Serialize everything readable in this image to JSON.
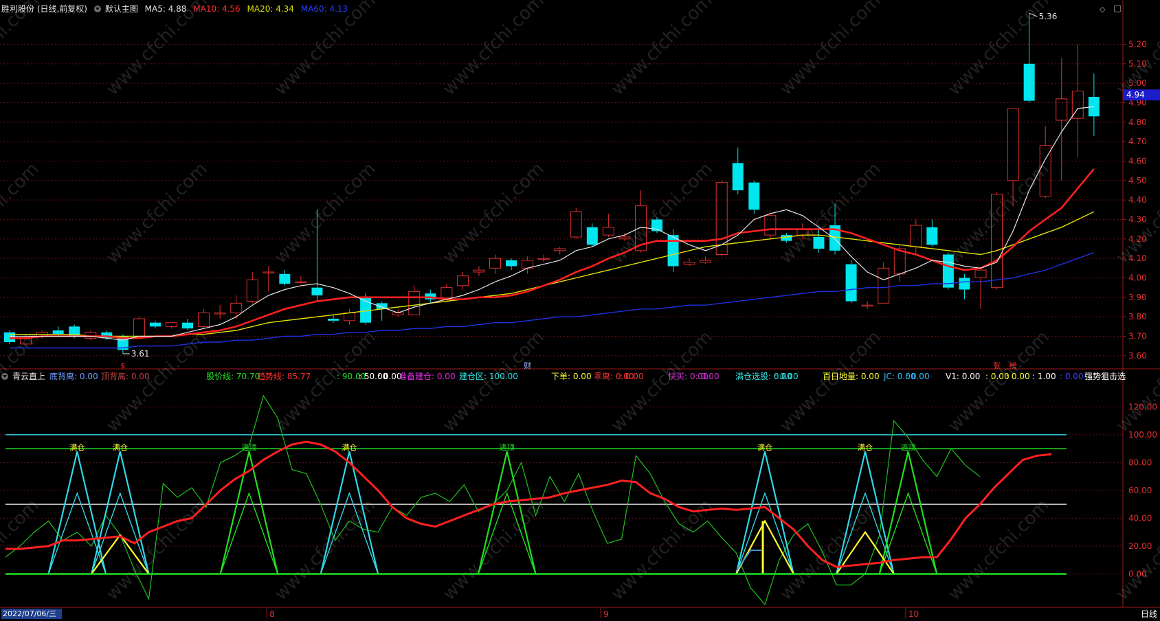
{
  "main_header": {
    "title": "胜利股份 (日线,前复权)",
    "template": "默认主图",
    "ma5": "MA5: 4.88",
    "ma10": "MA10: 4.56",
    "ma20": "MA20: 4.34",
    "ma60": "MA60: 4.13"
  },
  "sub_header": {
    "indicator": "青云直上",
    "items": [
      {
        "text": "底背离: 0.00",
        "color": "#6ea0ff"
      },
      {
        "text": "顶背离: 0.00",
        "color": "#c04040"
      },
      {
        "text": "股价线: 70.70",
        "color": "#20e020"
      },
      {
        "text": "趋势线: 85.77",
        "color": "#ff3030"
      },
      {
        "text": ": 90.00",
        "color": "#20e020"
      },
      {
        "text": ": 50.00",
        "color": "#ffffff"
      },
      {
        "text": ": 0.00",
        "color": "#ffffff"
      },
      {
        "text": "准备建仓: 0.00",
        "color": "#e030e0"
      },
      {
        "text": "建仓区: 100.00",
        "color": "#30e0e0"
      },
      {
        "text": "下单: 0.00",
        "color": "#ffff30"
      },
      {
        "text": "乖离: 0.00",
        "color": "#ff3030"
      },
      {
        "text": ": 0.00",
        "color": "#ff3030"
      },
      {
        "text": "快买: 0.00",
        "color": "#e030e0"
      },
      {
        "text": ": 0.00",
        "color": "#e030e0"
      },
      {
        "text": "满仓选股: 0.00",
        "color": "#30e0e0"
      },
      {
        "text": ": 0.00",
        "color": "#30e0e0"
      },
      {
        "text": "百日地量: 0.00",
        "color": "#ffff30"
      },
      {
        "text": "JC: 0.00",
        "color": "#30c0ff"
      },
      {
        "text": ": 0.00",
        "color": "#30c0ff"
      },
      {
        "text": "V1: 0.00",
        "color": "#ffffff"
      },
      {
        "text": ": 0.00",
        "color": "#ffff30"
      },
      {
        "text": ": 0.00",
        "color": "#ffff30"
      },
      {
        "text": ": 1.00",
        "color": "#ffffff"
      },
      {
        "text": ": 0.00",
        "color": "#4040ff"
      },
      {
        "text": "强势狙击选",
        "color": "#ffffff"
      }
    ]
  },
  "footer": {
    "date": "2022/07/06/三",
    "period": "日线"
  },
  "colors": {
    "up": "#e03030",
    "down": "#00e5ee",
    "ma5": "#e6e6e6",
    "ma10": "#ff2020",
    "ma20": "#e0e000",
    "ma60": "#2030e0",
    "grid": "#6a1010"
  },
  "chart_data": [
    {
      "type": "candlestick",
      "price_axis": [
        5.2,
        5.1,
        5.0,
        4.9,
        4.8,
        4.7,
        4.6,
        4.5,
        4.4,
        4.3,
        4.2,
        4.1,
        4.0,
        3.9,
        3.8,
        3.7,
        3.6
      ],
      "price_axis_labels": [
        "5.20",
        "5.10",
        "5.00",
        "4.90",
        "4.80",
        "4.70",
        "4.60",
        "4.50",
        "4.40",
        "4.30",
        "4.20",
        "4.10",
        "4.00",
        "3.90",
        "3.80",
        "3.70",
        "3.60"
      ],
      "ylim": [
        3.55,
        5.35
      ],
      "current_price": "4.94",
      "high_label": "5.36",
      "low_label": "3.61",
      "x_labels": [
        "8",
        "9",
        "10"
      ],
      "x_label_index": [
        18,
        41,
        62
      ],
      "markers": [
        {
          "index": 7,
          "text": "$",
          "color": "#ff3030"
        },
        {
          "index": 32,
          "text": "财",
          "color": "#8fb0ff"
        },
        {
          "index": 61,
          "text": "张",
          "color": "#ff3030"
        },
        {
          "index": 62,
          "text": "榜",
          "color": "#ff3030"
        }
      ],
      "candles": [
        [
          3.72,
          3.67,
          3.73,
          3.66
        ],
        [
          3.66,
          3.69,
          3.71,
          3.65
        ],
        [
          3.7,
          3.72,
          3.73,
          3.69
        ],
        [
          3.73,
          3.71,
          3.75,
          3.7
        ],
        [
          3.75,
          3.7,
          3.76,
          3.69
        ],
        [
          3.69,
          3.72,
          3.73,
          3.68
        ],
        [
          3.72,
          3.69,
          3.73,
          3.68
        ],
        [
          3.7,
          3.63,
          3.71,
          3.61
        ],
        [
          3.7,
          3.79,
          3.8,
          3.69
        ],
        [
          3.77,
          3.75,
          3.78,
          3.74
        ],
        [
          3.75,
          3.77,
          3.77,
          3.74
        ],
        [
          3.77,
          3.74,
          3.79,
          3.73
        ],
        [
          3.75,
          3.82,
          3.84,
          3.74
        ],
        [
          3.82,
          3.82,
          3.86,
          3.79
        ],
        [
          3.82,
          3.87,
          3.91,
          3.79
        ],
        [
          3.88,
          3.99,
          4.03,
          3.87
        ],
        [
          4.03,
          4.03,
          4.06,
          3.93
        ],
        [
          4.02,
          3.97,
          4.04,
          3.96
        ],
        [
          3.98,
          3.98,
          4.01,
          3.97
        ],
        [
          3.95,
          3.91,
          4.35,
          3.88
        ],
        [
          3.79,
          3.78,
          3.81,
          3.77
        ],
        [
          3.78,
          3.82,
          3.84,
          3.76
        ],
        [
          3.9,
          3.77,
          3.92,
          3.76
        ],
        [
          3.87,
          3.84,
          3.88,
          3.78
        ],
        [
          3.81,
          3.82,
          3.84,
          3.8
        ],
        [
          3.81,
          3.93,
          3.96,
          3.81
        ],
        [
          3.92,
          3.89,
          3.94,
          3.87
        ],
        [
          3.9,
          3.95,
          3.97,
          3.89
        ],
        [
          3.96,
          4.01,
          4.03,
          3.94
        ],
        [
          4.03,
          4.04,
          4.06,
          4.01
        ],
        [
          4.05,
          4.1,
          4.12,
          4.02
        ],
        [
          4.09,
          4.06,
          4.1,
          4.04
        ],
        [
          4.05,
          4.09,
          4.11,
          4.02
        ],
        [
          4.1,
          4.1,
          4.12,
          4.08
        ],
        [
          4.14,
          4.15,
          4.16,
          4.12
        ],
        [
          4.21,
          4.34,
          4.36,
          4.2
        ],
        [
          4.26,
          4.17,
          4.28,
          4.16
        ],
        [
          4.22,
          4.26,
          4.33,
          4.21
        ],
        [
          4.2,
          4.21,
          4.23,
          4.19
        ],
        [
          4.14,
          4.37,
          4.45,
          4.13
        ],
        [
          4.3,
          4.24,
          4.31,
          4.23
        ],
        [
          4.22,
          4.06,
          4.25,
          4.03
        ],
        [
          4.07,
          4.08,
          4.1,
          4.06
        ],
        [
          4.08,
          4.09,
          4.11,
          4.07
        ],
        [
          4.12,
          4.49,
          4.5,
          4.11
        ],
        [
          4.59,
          4.45,
          4.67,
          4.43
        ],
        [
          4.49,
          4.35,
          4.5,
          4.33
        ],
        [
          4.22,
          4.32,
          4.34,
          4.2
        ],
        [
          4.22,
          4.19,
          4.23,
          4.18
        ],
        [
          4.22,
          4.25,
          4.28,
          4.2
        ],
        [
          4.21,
          4.15,
          4.26,
          4.13
        ],
        [
          4.27,
          4.14,
          4.38,
          4.12
        ],
        [
          4.07,
          3.88,
          4.09,
          3.87
        ],
        [
          3.86,
          3.86,
          3.88,
          3.84
        ],
        [
          3.87,
          4.05,
          4.08,
          3.87
        ],
        [
          4.02,
          4.15,
          4.17,
          3.98
        ],
        [
          4.16,
          4.27,
          4.3,
          4.12
        ],
        [
          4.26,
          4.17,
          4.3,
          4.16
        ],
        [
          4.12,
          3.95,
          4.13,
          3.94
        ],
        [
          4.0,
          3.94,
          4.02,
          3.89
        ],
        [
          4.0,
          4.04,
          4.05,
          3.84
        ],
        [
          3.95,
          4.43,
          4.44,
          3.94
        ],
        [
          4.5,
          4.87,
          4.87,
          4.37
        ],
        [
          5.1,
          4.91,
          5.36,
          4.9
        ],
        [
          4.42,
          4.68,
          4.78,
          4.41
        ],
        [
          4.81,
          4.92,
          5.13,
          4.5
        ],
        [
          4.82,
          4.96,
          5.2,
          4.62
        ],
        [
          4.93,
          4.83,
          5.05,
          4.73
        ]
      ],
      "ma5": [
        3.7,
        3.7,
        3.7,
        3.7,
        3.7,
        3.7,
        3.69,
        3.68,
        3.7,
        3.7,
        3.7,
        3.72,
        3.74,
        3.76,
        3.8,
        3.86,
        3.91,
        3.94,
        3.96,
        3.97,
        3.95,
        3.92,
        3.88,
        3.85,
        3.82,
        3.85,
        3.87,
        3.89,
        3.91,
        3.94,
        3.98,
        4.01,
        4.05,
        4.07,
        4.09,
        4.14,
        4.16,
        4.2,
        4.22,
        4.26,
        4.25,
        4.21,
        4.17,
        4.14,
        4.17,
        4.22,
        4.3,
        4.33,
        4.35,
        4.32,
        4.26,
        4.2,
        4.11,
        4.03,
        3.99,
        4.02,
        4.05,
        4.09,
        4.08,
        4.06,
        4.05,
        4.08,
        4.24,
        4.45,
        4.61,
        4.75,
        4.87,
        4.88
      ],
      "ma10": [
        3.69,
        3.69,
        3.7,
        3.7,
        3.7,
        3.7,
        3.7,
        3.69,
        3.69,
        3.7,
        3.7,
        3.71,
        3.72,
        3.73,
        3.75,
        3.78,
        3.81,
        3.84,
        3.86,
        3.88,
        3.89,
        3.9,
        3.9,
        3.9,
        3.9,
        3.9,
        3.9,
        3.89,
        3.89,
        3.9,
        3.9,
        3.91,
        3.93,
        3.96,
        3.99,
        4.03,
        4.06,
        4.1,
        4.13,
        4.17,
        4.19,
        4.19,
        4.19,
        4.19,
        4.2,
        4.23,
        4.24,
        4.25,
        4.25,
        4.25,
        4.25,
        4.25,
        4.23,
        4.2,
        4.17,
        4.14,
        4.12,
        4.09,
        4.06,
        4.04,
        4.05,
        4.09,
        4.16,
        4.24,
        4.3,
        4.36,
        4.46,
        4.56
      ],
      "ma20": [
        3.71,
        3.71,
        3.71,
        3.71,
        3.71,
        3.7,
        3.7,
        3.7,
        3.7,
        3.7,
        3.7,
        3.71,
        3.71,
        3.72,
        3.73,
        3.75,
        3.77,
        3.78,
        3.79,
        3.8,
        3.81,
        3.82,
        3.83,
        3.84,
        3.85,
        3.86,
        3.87,
        3.88,
        3.89,
        3.9,
        3.91,
        3.92,
        3.94,
        3.96,
        3.98,
        4.0,
        4.02,
        4.04,
        4.06,
        4.08,
        4.1,
        4.12,
        4.14,
        4.16,
        4.17,
        4.18,
        4.19,
        4.2,
        4.21,
        4.22,
        4.22,
        4.21,
        4.2,
        4.19,
        4.18,
        4.17,
        4.16,
        4.15,
        4.14,
        4.13,
        4.12,
        4.14,
        4.17,
        4.2,
        4.23,
        4.26,
        4.3,
        4.34
      ],
      "ma60": [
        3.64,
        3.64,
        3.64,
        3.64,
        3.64,
        3.64,
        3.64,
        3.64,
        3.65,
        3.65,
        3.65,
        3.66,
        3.67,
        3.67,
        3.68,
        3.68,
        3.69,
        3.7,
        3.7,
        3.71,
        3.71,
        3.72,
        3.72,
        3.73,
        3.73,
        3.74,
        3.74,
        3.75,
        3.75,
        3.76,
        3.77,
        3.77,
        3.78,
        3.79,
        3.8,
        3.8,
        3.81,
        3.82,
        3.83,
        3.84,
        3.84,
        3.85,
        3.86,
        3.86,
        3.87,
        3.88,
        3.89,
        3.9,
        3.91,
        3.92,
        3.93,
        3.93,
        3.94,
        3.95,
        3.95,
        3.96,
        3.96,
        3.97,
        3.97,
        3.98,
        3.98,
        3.99,
        4.0,
        4.02,
        4.04,
        4.07,
        4.1,
        4.13
      ]
    },
    {
      "type": "line",
      "axis": [
        120.0,
        100.0,
        80.0,
        60.0,
        40.0,
        20.0,
        0.0
      ],
      "axis_labels": [
        "120.00",
        "100.00",
        "80.00",
        "60.00",
        "40.00",
        "20.00",
        "0.00"
      ],
      "ylim": [
        -22,
        135
      ],
      "ref_lines": [
        {
          "value": 100,
          "color": "#30d0e0"
        },
        {
          "value": 90,
          "color": "#20e020"
        },
        {
          "value": 50,
          "color": "#d8d8d8"
        }
      ],
      "trend_line": [
        18,
        18,
        19,
        20,
        24,
        24,
        25,
        26,
        27,
        22,
        30,
        34,
        38,
        40,
        50,
        60,
        68,
        74,
        82,
        88,
        93,
        95,
        93,
        88,
        80,
        70,
        60,
        48,
        40,
        36,
        34,
        38,
        42,
        46,
        50,
        52,
        53,
        54,
        55,
        58,
        60,
        62,
        64,
        67,
        66,
        58,
        54,
        48,
        45,
        46,
        47,
        46,
        47,
        48,
        40,
        32,
        20,
        10,
        5,
        6,
        7,
        8,
        10,
        11,
        12,
        12,
        25,
        40,
        50,
        62,
        72,
        82,
        85,
        86
      ],
      "price_line": [
        12,
        20,
        30,
        38,
        24,
        30,
        20,
        42,
        28,
        3,
        -18,
        65,
        55,
        62,
        48,
        80,
        85,
        92,
        128,
        112,
        75,
        72,
        50,
        24,
        38,
        32,
        30,
        48,
        42,
        55,
        58,
        52,
        64,
        45,
        50,
        60,
        80,
        42,
        70,
        52,
        72,
        45,
        22,
        25,
        85,
        72,
        52,
        36,
        30,
        38,
        26,
        15,
        -10,
        -22,
        10,
        28,
        36,
        16,
        -8,
        -8,
        0,
        28,
        110,
        98,
        82,
        70,
        90,
        78,
        70
      ],
      "full_signals": [
        {
          "index": 5,
          "text": "满仓"
        },
        {
          "index": 8,
          "text": "满仓"
        },
        {
          "index": 24,
          "text": "满仓"
        },
        {
          "index": 53,
          "text": "满仓"
        },
        {
          "index": 60,
          "text": "满仓"
        }
      ],
      "escape_signals": [
        {
          "index": 17,
          "text": "逃顶"
        },
        {
          "index": 35,
          "text": "逃顶"
        },
        {
          "index": 63,
          "text": "逃顶"
        }
      ],
      "yellow_spikes": [
        {
          "index": 8,
          "value": 28
        },
        {
          "index": 53,
          "value": 38
        },
        {
          "index": 60,
          "value": 30
        }
      ]
    }
  ]
}
